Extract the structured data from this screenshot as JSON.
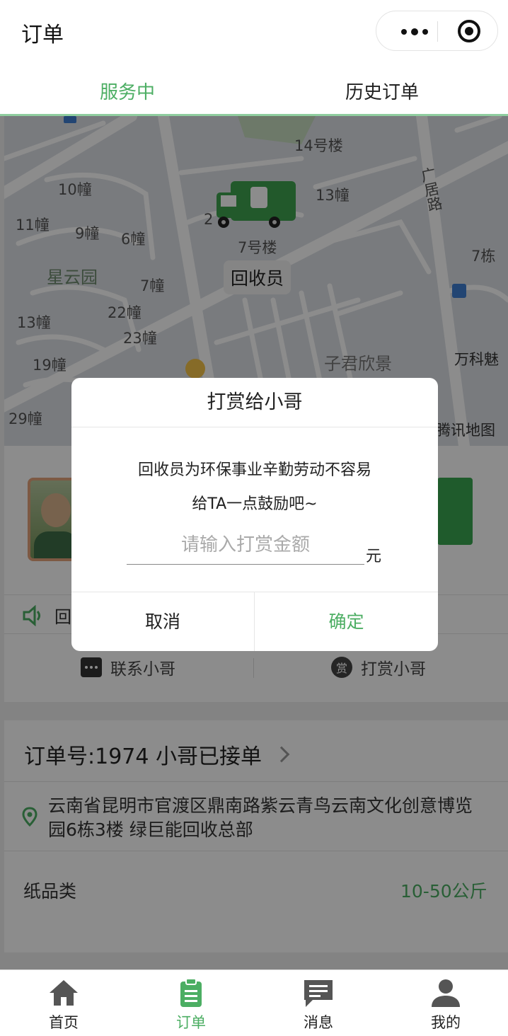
{
  "nav": {
    "title": "订单"
  },
  "tabs": [
    {
      "label": "服务中",
      "active": true
    },
    {
      "label": "历史订单",
      "active": false
    }
  ],
  "map": {
    "courier_tag": "回收员",
    "labels": {
      "b14": "14号楼",
      "b10": "10幢",
      "b13a": "13幢",
      "b11": "11幢",
      "b9": "9幢",
      "b6": "6幢",
      "b2": "2",
      "b7lou": "7号楼",
      "road": "广居路",
      "b7dong": "7栋",
      "park": "星云园",
      "b7": "7幢",
      "b22": "22幢",
      "b13b": "13幢",
      "b23": "23幢",
      "b19": "19幢",
      "b29": "29幢",
      "estate": "子君欣景",
      "vanke": "万科魅",
      "watermark": "腾讯地图"
    }
  },
  "courier_card": {
    "notice": "回",
    "contact_label": "联系小哥",
    "reward_label": "打赏小哥",
    "reward_icon_text": "赏"
  },
  "order": {
    "header": "订单号:1974 小哥已接单",
    "address": "云南省昆明市官渡区鼎南路紫云青鸟云南文化创意博览园6栋3楼 绿巨能回收总部",
    "category": "纸品类",
    "weight": "10-50公斤"
  },
  "dialog": {
    "title": "打赏给小哥",
    "line1": "回收员为环保事业辛勤劳动不容易",
    "line2": "给TA一点鼓励吧~",
    "input_placeholder": "请输入打赏金额",
    "input_value": "",
    "unit": "元",
    "cancel_label": "取消",
    "confirm_label": "确定"
  },
  "tabbar": [
    {
      "label": "首页",
      "icon": "home-icon"
    },
    {
      "label": "订单",
      "icon": "clipboard-icon",
      "active": true
    },
    {
      "label": "消息",
      "icon": "message-icon"
    },
    {
      "label": "我的",
      "icon": "user-icon"
    }
  ],
  "colors": {
    "accent": "#4cae63",
    "mask": "rgba(0,0,0,0.45)"
  }
}
